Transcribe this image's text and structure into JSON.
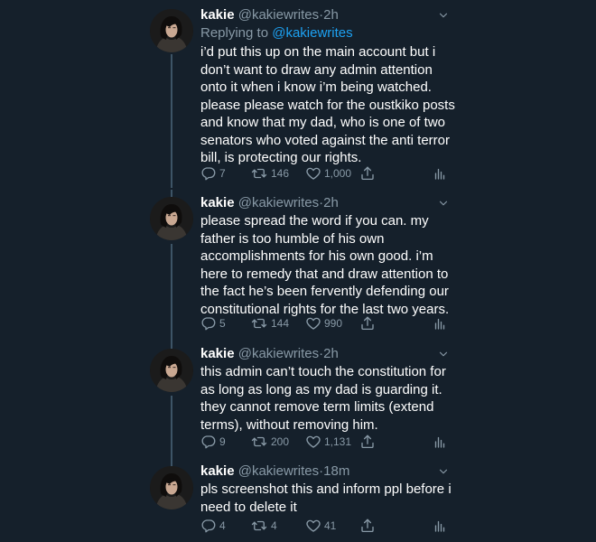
{
  "colors": {
    "background": "#15202b",
    "text": "#ffffff",
    "muted": "#8899a6",
    "link": "#1da1f2",
    "thread_line": "#3d5466"
  },
  "tweets": [
    {
      "name": "kakie",
      "handle": "@kakiewrites",
      "dot": "·",
      "time": "2h",
      "replying_prefix": "Replying to ",
      "replying_to": "@kakiewrites",
      "text": "i’d put this up on the main account but i\ndon’t want to draw any admin attention\nonto it when i know i’m being watched.\nplease please watch for the oustkiko posts\nand know that my dad, who is one of two\nsenators who voted against the anti terror\nbill, is protecting our rights.",
      "replies": "7",
      "retweets": "146",
      "likes": "1,000",
      "icons": [
        "reply-icon",
        "retweet-icon",
        "like-icon",
        "share-icon",
        "analytics-icon"
      ]
    },
    {
      "name": "kakie",
      "handle": "@kakiewrites",
      "dot": "·",
      "time": "2h",
      "text": "please spread the word if you can. my\nfather is too humble of his own\naccomplishments for his own good. i’m\nhere to remedy that and draw attention to\nthe fact he’s been fervently defending our\nconstitutional rights for the last two years.",
      "replies": "5",
      "retweets": "144",
      "likes": "990",
      "icons": [
        "reply-icon",
        "retweet-icon",
        "like-icon",
        "share-icon",
        "analytics-icon"
      ]
    },
    {
      "name": "kakie",
      "handle": "@kakiewrites",
      "dot": "·",
      "time": "2h",
      "text": "this admin can’t touch the constitution for\nas long as long as my dad is guarding it.\nthey cannot remove term limits (extend\nterms), without removing him.",
      "replies": "9",
      "retweets": "200",
      "likes": "1,131",
      "icons": [
        "reply-icon",
        "retweet-icon",
        "like-icon",
        "share-icon",
        "analytics-icon"
      ]
    },
    {
      "name": "kakie",
      "handle": "@kakiewrites",
      "dot": "·",
      "time": "18m",
      "text": "pls screenshot this and inform ppl before i\nneed to delete it",
      "replies": "4",
      "retweets": "4",
      "likes": "41",
      "icons": [
        "reply-icon",
        "retweet-icon",
        "like-icon",
        "share-icon",
        "analytics-icon"
      ]
    }
  ]
}
